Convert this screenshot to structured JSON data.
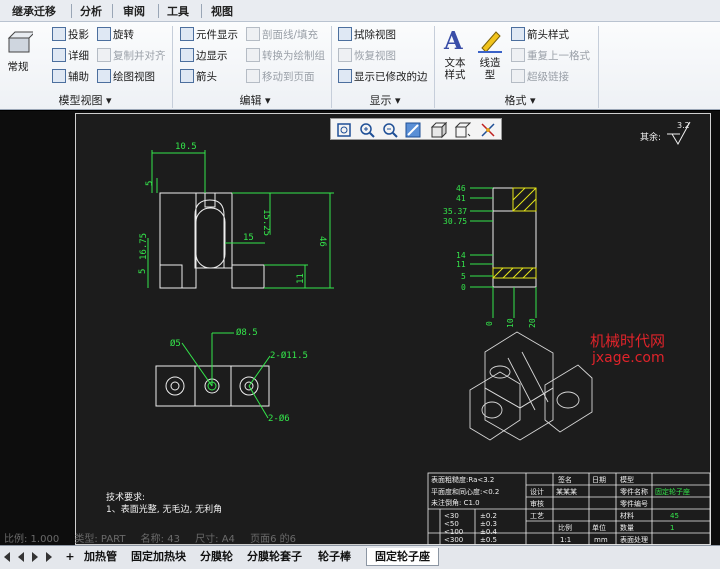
{
  "tabs": [
    "继承迁移",
    "分析",
    "审阅",
    "工具",
    "视图"
  ],
  "ribbon": {
    "model_view": {
      "label": "模型视图",
      "normal": "常规",
      "projection": "投影",
      "detail": "详细",
      "auxiliary": "辅助",
      "rotate": "旋转",
      "copy_align": "复制并对齐",
      "drawing_view": "绘图视图"
    },
    "edit": {
      "label": "编辑",
      "element_display": "元件显示",
      "edge_display": "边显示",
      "arrow": "箭头",
      "section_fill": "剖面线/填充",
      "convert_draft": "转换为绘制组",
      "move_to_page": "移动到页面"
    },
    "display": {
      "label": "显示",
      "erase_view": "拭除视图",
      "restore_view": "恢复视图",
      "show_modified_edges": "显示已修改的边"
    },
    "format": {
      "label": "格式",
      "text_style": "文本样式",
      "line_style": "线造型",
      "arrow_style": "箭头样式",
      "repeat_last": "重复上一格式",
      "hyperlink": "超级链接"
    }
  },
  "drawing": {
    "roughness_note": "其余:",
    "roughness_value": "3.2",
    "dims": {
      "d10_5": "10.5",
      "d5a": "5",
      "d15_25": "15.25",
      "d16_75": "16.75",
      "d46": "46",
      "d15": "15",
      "d11": "11",
      "d5b": "5",
      "d8_5": "Ø8.5",
      "d5c": "Ø5",
      "d11_5": "2-Ø11.5",
      "d6": "2-Ø6"
    },
    "right_dims": [
      "46",
      "41",
      "35.37",
      "30.75",
      "14",
      "11",
      "5",
      "0"
    ],
    "bottom_dims": [
      "0",
      "10",
      "20"
    ],
    "tech_req_title": "技术要求:",
    "tech_req_1": "1、表面光整, 无毛边, 无利角"
  },
  "title_block": {
    "r1": [
      "表面粗糙度:Ra<3.2",
      "签名",
      "日期",
      "模型"
    ],
    "r2": [
      "平面度和同心度:<0.2",
      "设计",
      "某某某",
      "零件名称",
      "固定轮子座"
    ],
    "r3": [
      "未注倒角: C1.0",
      "审核",
      "零件编号"
    ],
    "r4": [
      "工艺",
      "材料",
      "45"
    ],
    "r5": [
      "比例",
      "单位",
      "数量",
      "1"
    ],
    "r6": [
      "1:1",
      "mm",
      "表面处理"
    ],
    "tol_rows": [
      [
        "<30",
        "±0.2"
      ],
      [
        "<50",
        "±0.3"
      ],
      [
        "<100",
        "±0.4"
      ],
      [
        "<300",
        "±0.5"
      ]
    ]
  },
  "watermark": {
    "cn": "机械时代网",
    "en": "jxage.com"
  },
  "status": {
    "ratio": "比例: 1.000",
    "type": "类型: PART",
    "name": "名称: 43",
    "size": "尺寸: A4",
    "page": "页面6 的6"
  },
  "sheet_tabs": [
    "加热管",
    "固定加热块",
    "分膜轮",
    "分膜轮套子",
    "轮子棒",
    "固定轮子座"
  ],
  "add_sheet_label": "+",
  "colors": {
    "line_green": "#34e64b",
    "line_yellow": "#e6e61a",
    "drawing_white": "#eeeeee",
    "watermark_red": "#e0232a"
  }
}
